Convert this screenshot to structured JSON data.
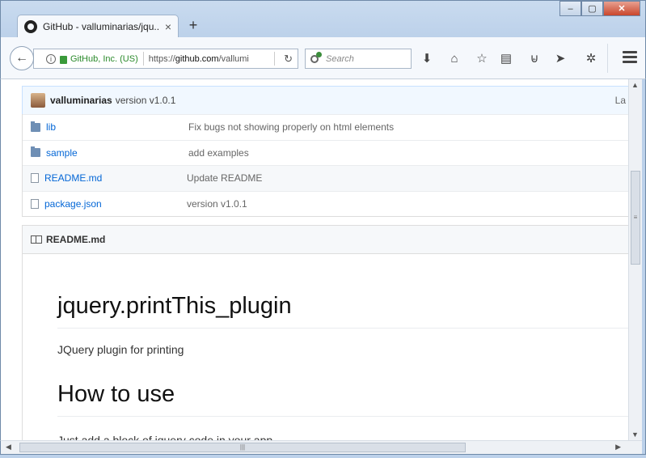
{
  "window": {
    "tab_title": "GitHub - valluminarias/jqu...",
    "tab_close": "×",
    "new_tab": "+",
    "minimize": "–",
    "maximize": "▢",
    "close": "✕"
  },
  "navbar": {
    "back": "←",
    "identity_org": "GitHub, Inc. (US)",
    "url_prefix": "https://",
    "url_host": "github.com",
    "url_path": "/vallumi",
    "reload": "↻",
    "search_placeholder": "Search",
    "icons": [
      "download-icon",
      "home-icon",
      "bookmark-star-icon",
      "reader-view-icon",
      "pocket-icon",
      "send-icon",
      "extension-icon",
      "menu-icon"
    ]
  },
  "commit": {
    "author": "valluminarias",
    "message": "version v1.0.1",
    "latest": "La"
  },
  "files": [
    {
      "type": "folder",
      "name": "lib",
      "message": "Fix bugs not showing properly on html elements"
    },
    {
      "type": "folder",
      "name": "sample",
      "message": "add examples"
    },
    {
      "type": "file",
      "name": "README.md",
      "message": "Update README"
    },
    {
      "type": "file",
      "name": "package.json",
      "message": "version v1.0.1"
    }
  ],
  "readme": {
    "header": "README.md",
    "title": "jquery.printThis_plugin",
    "description": "JQuery plugin for printing",
    "section_title": "How to use",
    "section_text": "Just add a block of jquery code in your app"
  },
  "scrollbars": {
    "grip": "≡",
    "hgrip": "|||",
    "up": "▲",
    "down": "▼",
    "left": "◀",
    "right": "▶"
  }
}
